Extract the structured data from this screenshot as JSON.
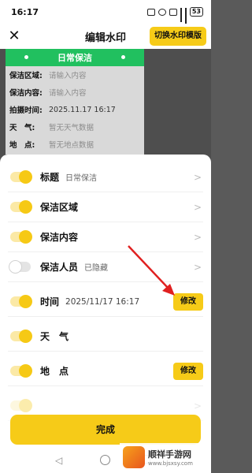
{
  "status_bar": {
    "time": "16:17",
    "battery": "53"
  },
  "header": {
    "title": "编辑水印",
    "switch_template": "切换水印模版"
  },
  "watermark": {
    "title": "日常保洁",
    "rows": [
      {
        "label": "保洁区域:",
        "value": "请输入内容"
      },
      {
        "label": "保洁内容:",
        "value": "请输入内容"
      },
      {
        "label": "拍摄时间:",
        "value": "2025.11.17 16:17"
      },
      {
        "label": "天　气:",
        "value": "暂无天气数据"
      },
      {
        "label": "地　点:",
        "value": "暂无地点数据"
      }
    ]
  },
  "settings": [
    {
      "label": "标题",
      "value": "日常保洁",
      "enabled": true,
      "action": "chevron"
    },
    {
      "label": "保洁区域",
      "value": "",
      "enabled": true,
      "action": "chevron"
    },
    {
      "label": "保洁内容",
      "value": "",
      "enabled": true,
      "action": "chevron"
    },
    {
      "label": "保洁人员",
      "value": "已隐藏",
      "enabled": false,
      "action": "chevron"
    },
    {
      "label": "时间",
      "value": "2025/11/17 16:17",
      "enabled": true,
      "action": "修改"
    },
    {
      "label": "天　气",
      "value": "",
      "enabled": true,
      "action": "none"
    },
    {
      "label": "地　点",
      "value": "",
      "enabled": true,
      "action": "修改"
    },
    {
      "label": "",
      "value": "",
      "enabled": true,
      "action": "chevron"
    }
  ],
  "done_button": "完成",
  "logo": {
    "title": "顺祥手游网",
    "sub": "www.bjsxsy.com"
  },
  "colors": {
    "accent": "#f6cb18",
    "watermark_header": "#21c05f",
    "arrow": "#e02020"
  },
  "icons": [
    "close-icon",
    "chevron-right-icon",
    "back-icon",
    "home-icon",
    "recent-apps-icon"
  ]
}
